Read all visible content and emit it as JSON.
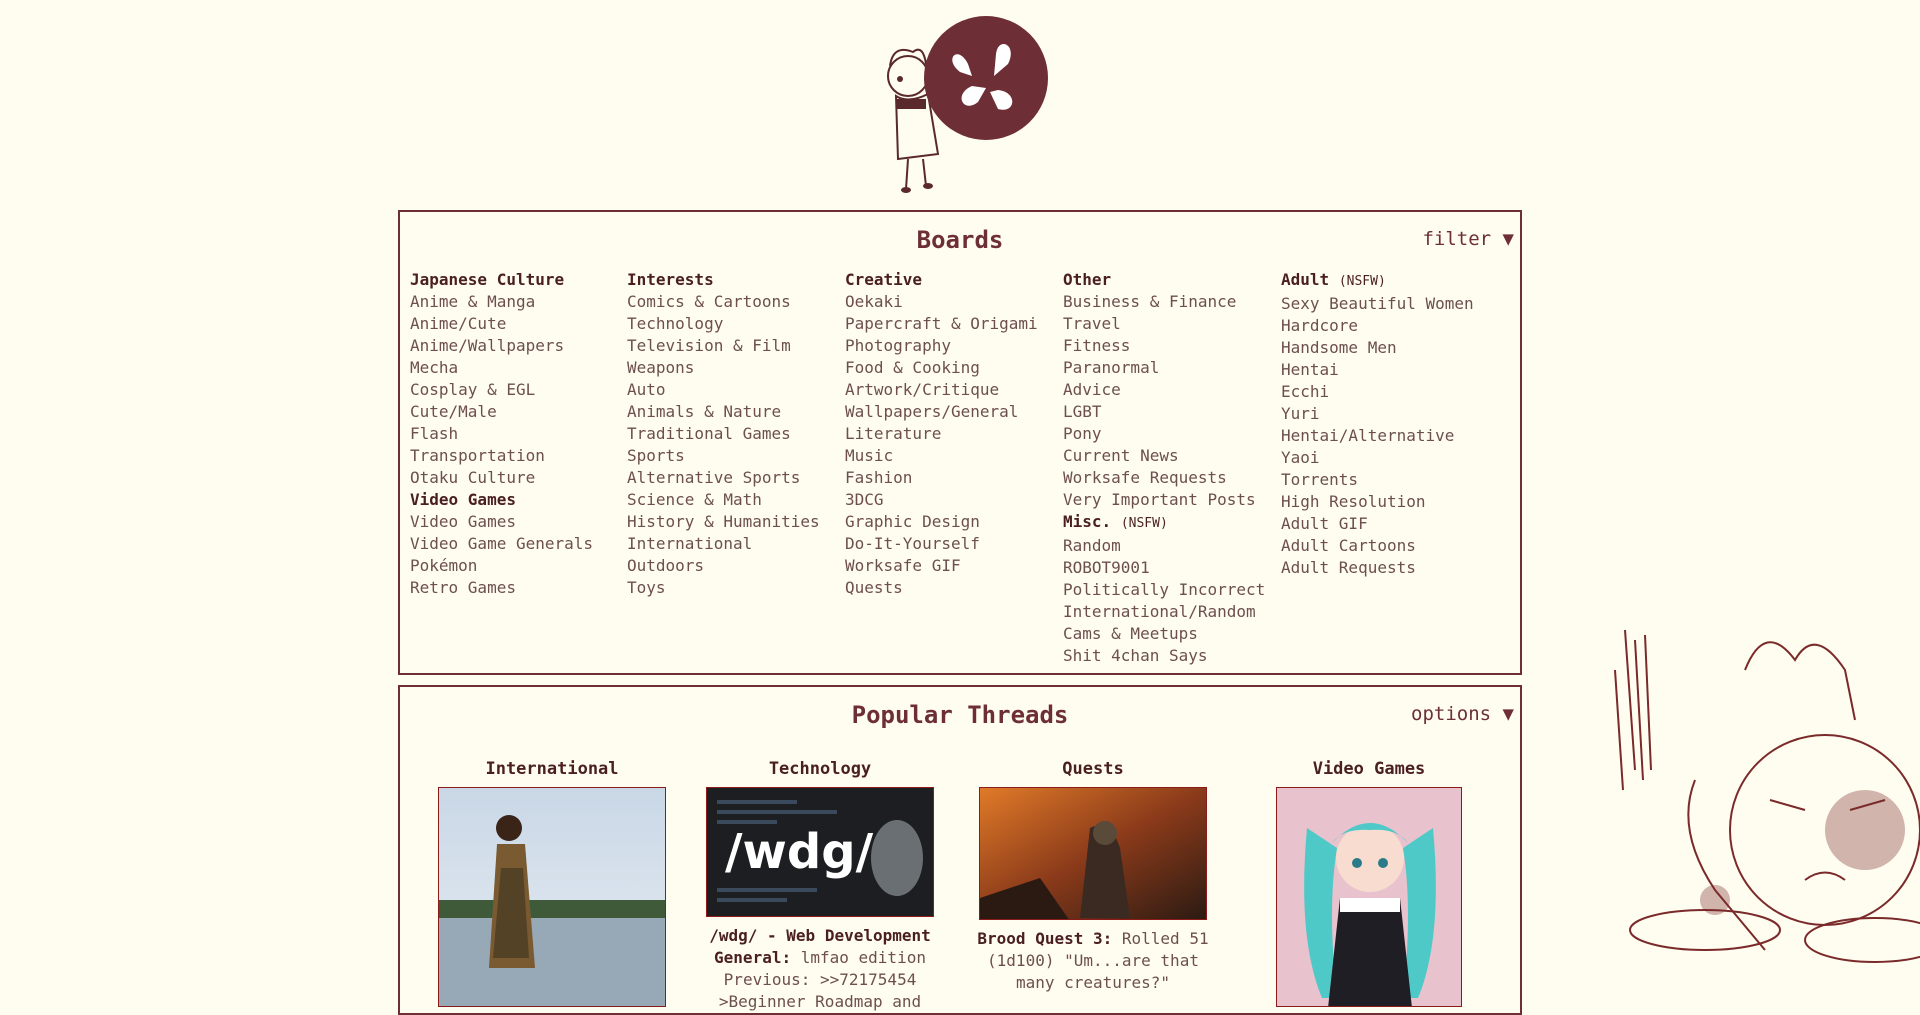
{
  "colors": {
    "background": "#fffdf0",
    "accent": "#6d2f35",
    "text": "#6d4f4f",
    "heading": "#4a1f22"
  },
  "logo": {
    "name": "clover-logo-with-mascot"
  },
  "boards": {
    "title": "Boards",
    "filter_label": "filter ▼",
    "columns": [
      {
        "groups": [
          {
            "heading": "Japanese Culture",
            "nsfw": "",
            "items": [
              "Anime & Manga",
              "Anime/Cute",
              "Anime/Wallpapers",
              "Mecha",
              "Cosplay & EGL",
              "Cute/Male",
              "Flash",
              "Transportation",
              "Otaku Culture"
            ]
          },
          {
            "heading": "Video Games",
            "nsfw": "",
            "items": [
              "Video Games",
              "Video Game Generals",
              "Pokémon",
              "Retro Games"
            ]
          }
        ]
      },
      {
        "groups": [
          {
            "heading": "Interests",
            "nsfw": "",
            "items": [
              "Comics & Cartoons",
              "Technology",
              "Television & Film",
              "Weapons",
              "Auto",
              "Animals & Nature",
              "Traditional Games",
              "Sports",
              "Alternative Sports",
              "Science & Math",
              "History & Humanities",
              "International",
              "Outdoors",
              "Toys"
            ]
          }
        ]
      },
      {
        "groups": [
          {
            "heading": "Creative",
            "nsfw": "",
            "items": [
              "Oekaki",
              "Papercraft & Origami",
              "Photography",
              "Food & Cooking",
              "Artwork/Critique",
              "Wallpapers/General",
              "Literature",
              "Music",
              "Fashion",
              "3DCG",
              "Graphic Design",
              "Do-It-Yourself",
              "Worksafe GIF",
              "Quests"
            ]
          }
        ]
      },
      {
        "groups": [
          {
            "heading": "Other",
            "nsfw": "",
            "items": [
              "Business & Finance",
              "Travel",
              "Fitness",
              "Paranormal",
              "Advice",
              "LGBT",
              "Pony",
              "Current News",
              "Worksafe Requests",
              "Very Important Posts"
            ]
          },
          {
            "heading": "Misc.",
            "nsfw": "(NSFW)",
            "items": [
              "Random",
              "ROBOT9001",
              "Politically Incorrect",
              "International/Random",
              "Cams & Meetups",
              "Shit 4chan Says"
            ]
          }
        ]
      },
      {
        "groups": [
          {
            "heading": "Adult",
            "nsfw": "(NSFW)",
            "items": [
              "Sexy Beautiful Women",
              "Hardcore",
              "Handsome Men",
              "Hentai",
              "Ecchi",
              "Yuri",
              "Hentai/Alternative",
              "Yaoi",
              "Torrents",
              "High Resolution",
              "Adult GIF",
              "Adult Cartoons",
              "Adult Requests"
            ]
          }
        ]
      }
    ]
  },
  "popular": {
    "title": "Popular Threads",
    "options_label": "options ▼",
    "threads": [
      {
        "board": "International",
        "subject": "",
        "excerpt": ""
      },
      {
        "board": "Technology",
        "thumb_text": "/wdg/",
        "subject": "/wdg/ - Web Development General:",
        "excerpt": "lmfao edition Previous: >>72175454 >Beginner Roadmap and"
      },
      {
        "board": "Quests",
        "subject": "Brood Quest 3:",
        "excerpt": "Rolled 51 (1d100) \"Um...are that many creatures?\""
      },
      {
        "board": "Video Games",
        "subject": "",
        "excerpt": ""
      }
    ]
  }
}
